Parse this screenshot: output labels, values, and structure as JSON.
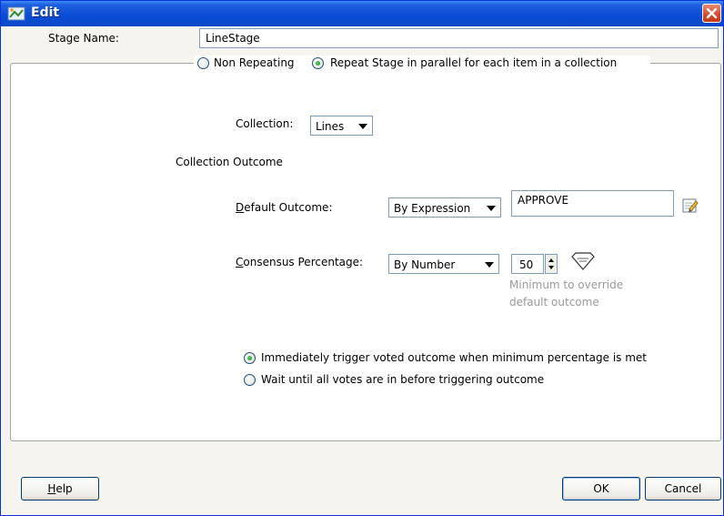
{
  "window": {
    "title": "Edit"
  },
  "stage": {
    "label": "Stage Name:",
    "value": "LineStage"
  },
  "repeat_mode": {
    "non_repeating": {
      "label": "Non Repeating",
      "checked": false
    },
    "parallel": {
      "label": "Repeat Stage in parallel for each item in a collection",
      "checked": true
    }
  },
  "collection": {
    "label": "Collection:",
    "value": "Lines"
  },
  "collection_outcome": {
    "heading": "Collection Outcome"
  },
  "default_outcome": {
    "label_prefix": "D",
    "label_rest": "efault Outcome:",
    "mode": "By Expression",
    "value": "APPROVE",
    "edit_icon": "edit-pencil-icon"
  },
  "consensus": {
    "label_prefix": "C",
    "label_rest": "onsensus Percentage:",
    "mode": "By Number",
    "value": "50",
    "hint_line1": "Minimum to override",
    "hint_line2": "default outcome",
    "icon": "vote-shield-icon"
  },
  "trigger": {
    "immediate": {
      "label": "Immediately trigger voted outcome when minimum percentage is met",
      "checked": true
    },
    "wait": {
      "label": "Wait until all votes are in before triggering outcome",
      "checked": false
    }
  },
  "buttons": {
    "help_prefix": "H",
    "help_rest": "elp",
    "ok": "OK",
    "cancel": "Cancel"
  }
}
